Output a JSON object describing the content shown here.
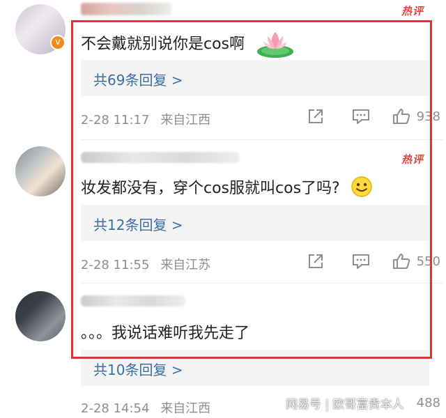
{
  "hot_label": "热评",
  "comments": [
    {
      "text": "不会戴就别说你是cos啊",
      "emoji": "lotus-emoji",
      "replies": "共69条回复 >",
      "date": "2-28 11:17",
      "location": "来自江西",
      "likes": "938",
      "verified": "v"
    },
    {
      "text": "妆发都没有，穿个cos服就叫cos了吗?",
      "emoji": "smile-emoji",
      "replies": "共12条回复 >",
      "date": "2-28 11:55",
      "location": "来自江苏",
      "likes": "550"
    },
    {
      "text": "。。。我说话难听我先走了",
      "replies": "共10条回复 >",
      "date": "2-28 14:54",
      "location": "来自江西",
      "likes": "488"
    }
  ],
  "watermark": "网易号 | 欧哥富贵本人",
  "colors": {
    "highlight_border": "#df3340",
    "hot_tag": "#e8433f",
    "reply_link": "#3a6ea5",
    "meta_gray": "#8e8e8e",
    "reply_bg": "#f4f4f4",
    "verified_badge": "#f28b1e"
  }
}
